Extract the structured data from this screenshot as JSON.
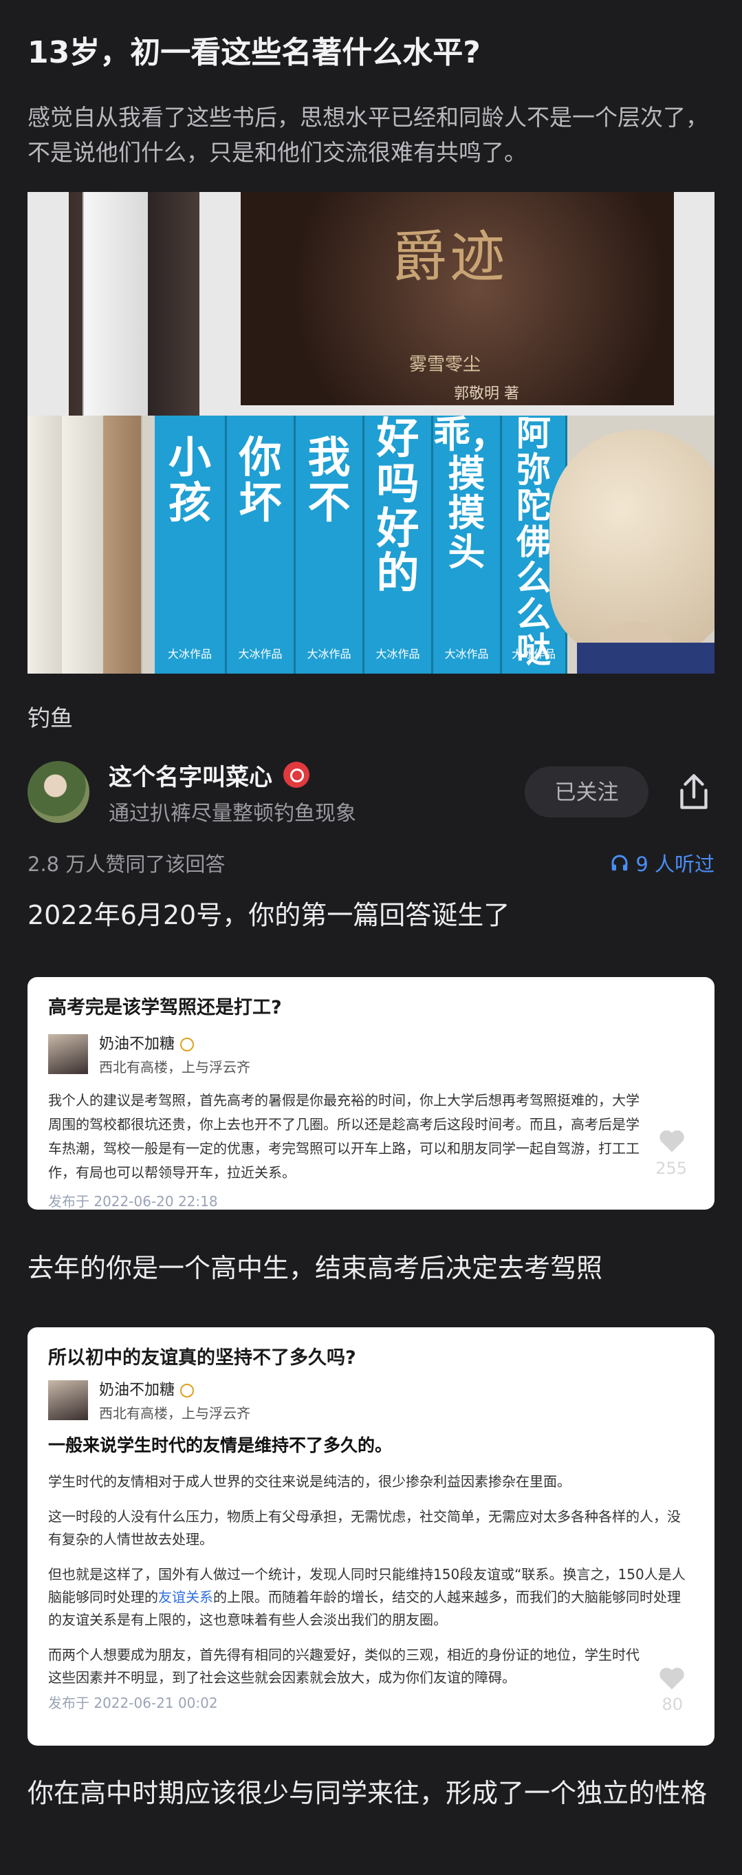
{
  "question": {
    "title": "13岁，初一看这些名著什么水平?",
    "description": "感觉自从我看了这些书后，思想水平已经和同龄人不是一个层次了，不是说他们什么，只是和他们交流很难有共鸣了。"
  },
  "hero_image": {
    "cover_title": "爵迹",
    "cover_subtitle": "雾雪零尘",
    "cover_author": "郭敬明 著",
    "spines": [
      "小孩",
      "你坏",
      "我不",
      "好吗好的",
      "乖，摸摸头",
      "阿弥陀佛么么哒"
    ],
    "spine_publisher": "大冰作品"
  },
  "topic": "钓鱼",
  "author": {
    "name": "这个名字叫菜心",
    "signature": "通过扒裤尽量整顿钓鱼现象",
    "follow_label": "已关注"
  },
  "meta": {
    "likes": "2.8 万人赞同了该回答",
    "listen": "9 人听过"
  },
  "answer": {
    "p1": "2022年6月20号，你的第一篇回答诞生了",
    "p2": "去年的你是一个高中生，结束高考后决定去考驾照",
    "p3": "你在高中时期应该很少与同学来往，形成了一个独立的性格"
  },
  "card1": {
    "title": "高考完是该学驾照还是打工?",
    "author_name": "奶油不加糖",
    "author_sig": "西北有高楼，上与浮云齐",
    "body": "我个人的建议是考驾照，首先高考的暑假是你最充裕的时间，你上大学后想再考驾照挺难的，大学周围的驾校都很坑还贵，你上去也开不了几圈。所以还是趁高考后这段时间考。而且，高考后是学车热潮，驾校一般是有一定的优惠，考完驾照可以开车上路，可以和朋友同学一起自驾游，打工工作，有局也可以帮领导开车，拉近关系。",
    "date": "发布于 2022-06-20 22:18",
    "likes": "255"
  },
  "card2": {
    "title": "所以初中的友谊真的坚持不了多久吗?",
    "author_name": "奶油不加糖",
    "author_sig": "西北有高楼，上与浮云齐",
    "bold_line": "一般来说学生时代的友情是维持不了多久的。",
    "p1": "学生时代的友情相对于成人世界的交往来说是纯洁的，很少掺杂利益因素掺杂在里面。",
    "p2": "这一时段的人没有什么压力，物质上有父母承担，无需忧虑，社交简单，无需应对太多各种各样的人，没有复杂的人情世故去处理。",
    "p3a": "但也就是这样了，国外有人做过一个统计，发现人同时只能维持150段友谊或“联系。换言之，150人是人脑能够同时处理的",
    "p3link": "友谊关系",
    "p3b": "的上限。而随着年龄的增长，结交的人越来越多，而我们的大脑能够同时处理的友谊关系是有上限的，这也意味着有些人会淡出我们的朋友圈。",
    "p4": "而两个人想要成为朋友，首先得有相同的兴趣爱好，类似的三观，相近的身份证的地位，学生时代这些因素并不明显，到了社会这些就会因素就会放大，成为你们友谊的障碍。",
    "date": "发布于 2022-06-21 00:02",
    "likes": "80"
  }
}
